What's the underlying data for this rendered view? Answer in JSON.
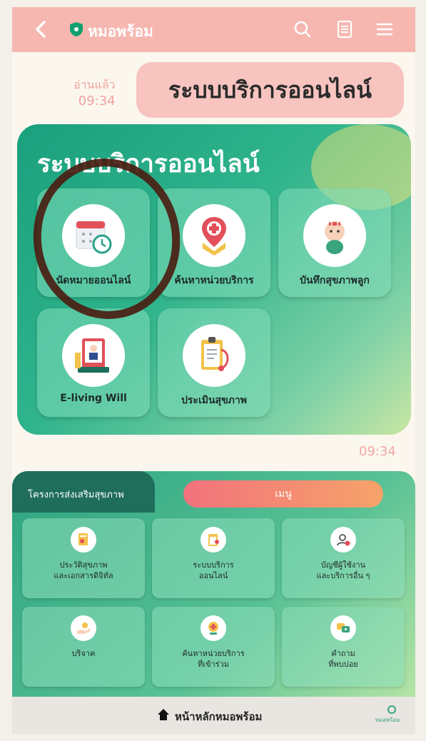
{
  "header": {
    "title": "หมอพร้อม",
    "icons": [
      "back-icon",
      "shield-icon",
      "search-icon",
      "notes-icon",
      "menu-icon"
    ]
  },
  "chat": {
    "read_status": "อ่านแล้ว",
    "sent_time": "09:34",
    "message": "ระบบบริการออนไลน์",
    "card_time": "09:34"
  },
  "card": {
    "title": "ระบบบริการออนไลน์",
    "items": [
      {
        "label": "นัดหมายออนไลน์",
        "icon": "calendar-clock-icon"
      },
      {
        "label": "ค้นหาหน่วยบริการ",
        "icon": "map-pin-cross-icon"
      },
      {
        "label": "บันทึกสุขภาพลูก",
        "icon": "baby-icon"
      },
      {
        "label": "E-living Will",
        "icon": "will-document-icon"
      },
      {
        "label": "ประเมินสุขภาพ",
        "icon": "clipboard-stethoscope-icon"
      }
    ]
  },
  "menu": {
    "tab_left": "โครงการส่งเสริมสุขภาพ",
    "tab_active": "เมนู",
    "items": [
      {
        "label": "ประวัติสุขภาพ\nและเอกสารดิจิทัล",
        "icon": "health-record-icon"
      },
      {
        "label": "ระบบบริการ\nออนไลน์",
        "icon": "online-service-icon"
      },
      {
        "label": "บัญชีผู้ใช้งาน\nและบริการอื่น ๆ",
        "icon": "user-account-icon"
      },
      {
        "label": "บริจาค",
        "icon": "donate-icon"
      },
      {
        "label": "ค้นหาหน่วยบริการ\nที่เข้าร่วม",
        "icon": "find-hospital-icon"
      },
      {
        "label": "คำถาม\nที่พบบ่อย",
        "icon": "faq-icon"
      }
    ]
  },
  "footer": {
    "home_label": "หน้าหลักหมอพร้อม",
    "brand_text": "หมอพร้อม"
  },
  "colors": {
    "header": "#f6b7b0",
    "bubble": "#f7c4bf",
    "card_green": "#1aa07d",
    "menu_tab": "#f2727c",
    "annotation_circle": "#4a1e12"
  }
}
